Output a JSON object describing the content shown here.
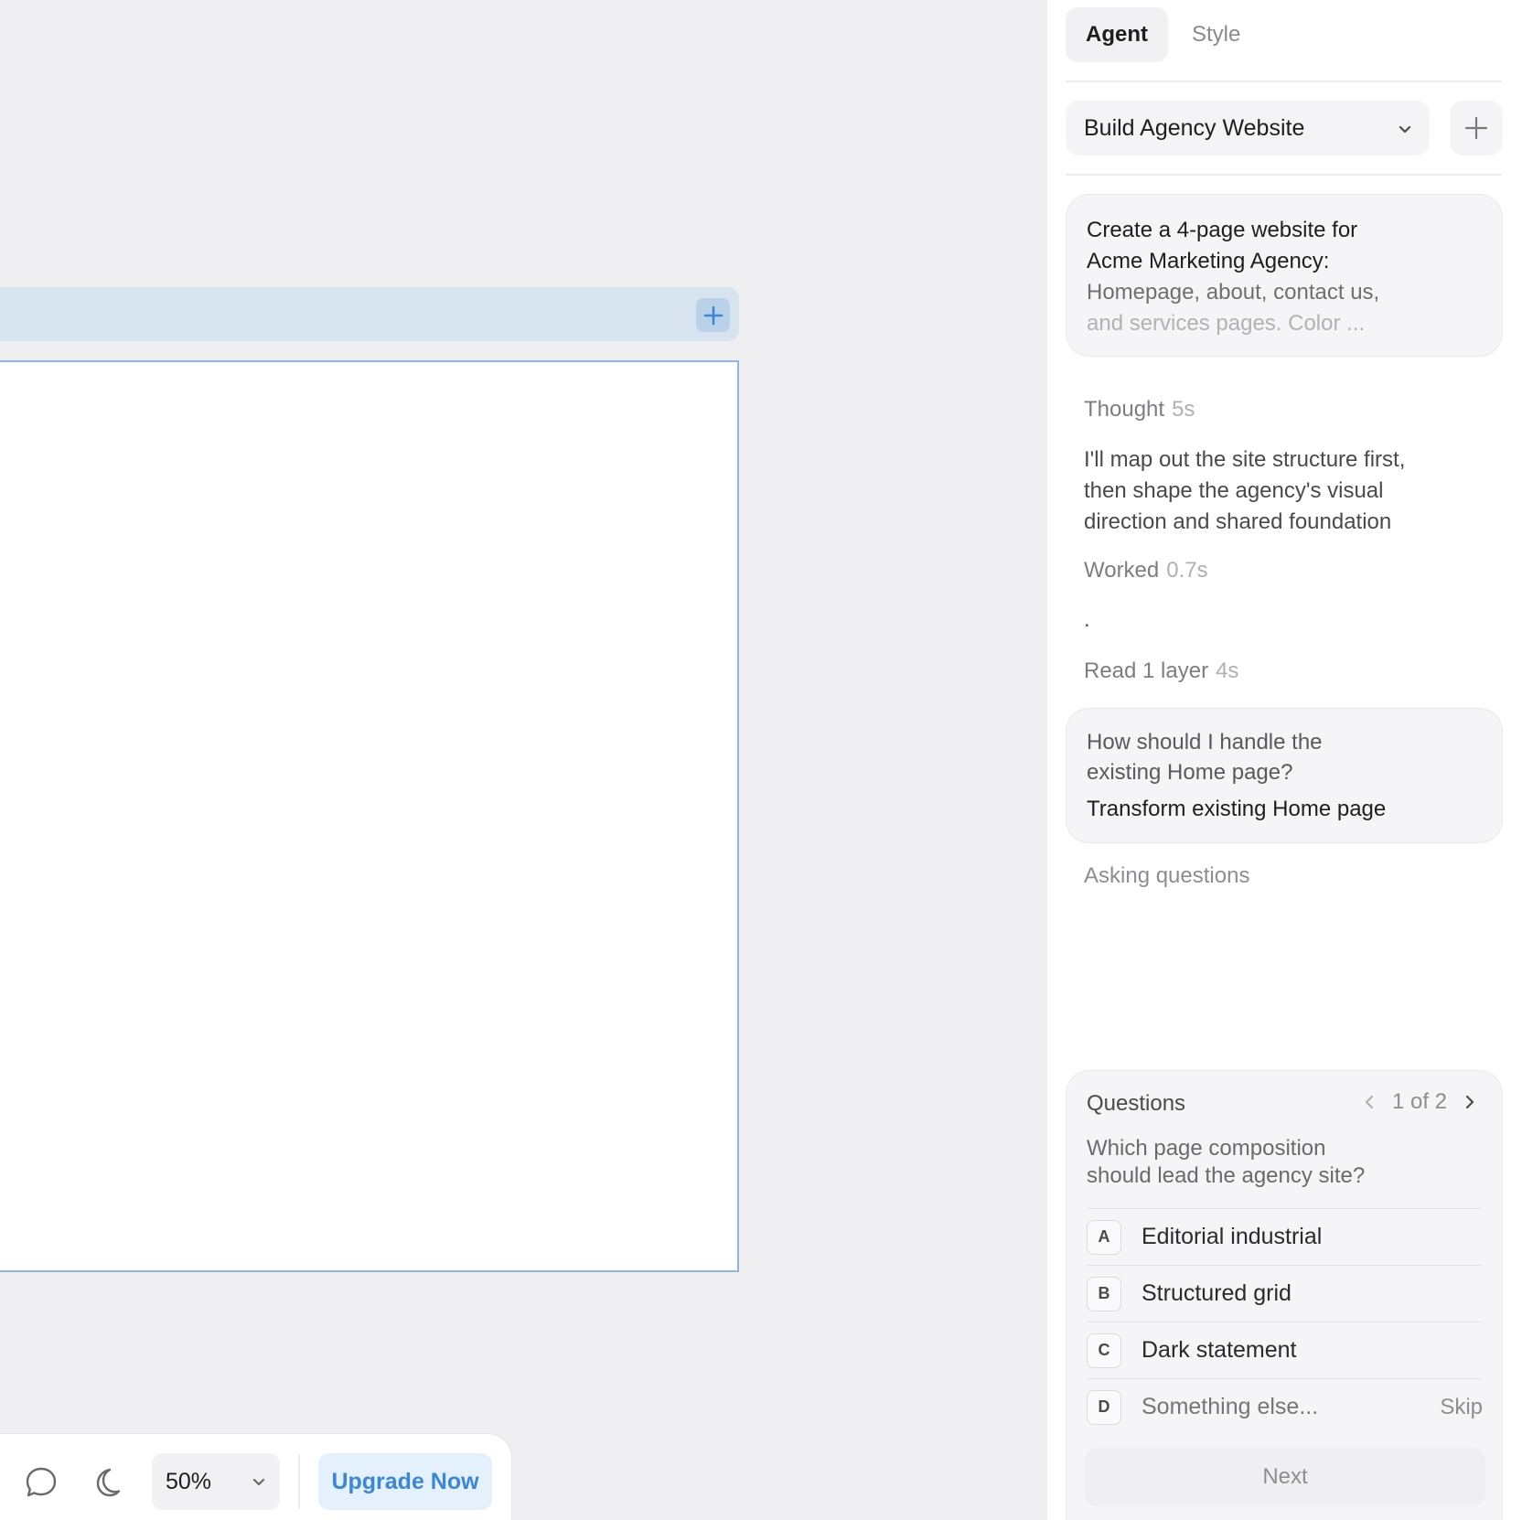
{
  "canvas": {
    "frame_add_icon": "plus-icon",
    "toolbar": {
      "comment_icon": "comment-bubble-icon",
      "theme_icon": "moon-icon",
      "zoom_value": "50%",
      "upgrade_label": "Upgrade Now"
    }
  },
  "panel": {
    "tabs": [
      {
        "label": "Agent",
        "active": true
      },
      {
        "label": "Style",
        "active": false
      }
    ],
    "project": {
      "selected": "Build Agency Website"
    },
    "prompt": {
      "line1": "Create a 4-page website for\nAcme Marketing Agency:",
      "line2": "Homepage, about, contact us,",
      "line3": "and services pages. Color ..."
    },
    "thought": {
      "label": "Thought",
      "time": "5s"
    },
    "thought_text": "I'll map out the site structure first,\nthen shape the agency's visual\ndirection and shared foundation",
    "worked": {
      "label": "Worked",
      "time": "0.7s"
    },
    "dot": ".",
    "read": {
      "label": "Read 1 layer",
      "time": "4s"
    },
    "question_card": {
      "question": "How should I handle the\nexisting Home page?",
      "answer": "Transform existing Home page"
    },
    "asking": "Asking questions",
    "questions": {
      "title": "Questions",
      "pager": "1 of 2",
      "question": "Which page composition\nshould lead the agency site?",
      "options": [
        {
          "key": "A",
          "label": "Editorial industrial"
        },
        {
          "key": "B",
          "label": "Structured grid"
        },
        {
          "key": "C",
          "label": "Dark statement"
        }
      ],
      "custom": {
        "key": "D",
        "placeholder": "Something else...",
        "skip": "Skip"
      },
      "next_label": "Next"
    }
  },
  "colors": {
    "accent": "#3a87d8",
    "canvas_bg": "#efeff1",
    "frame_header": "#d7e3ee",
    "panel_bg": "#ffffff"
  }
}
